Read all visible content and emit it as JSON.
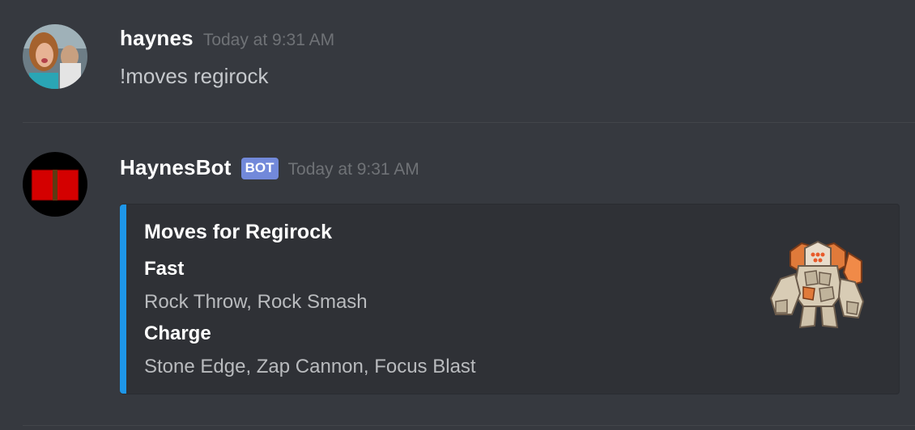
{
  "messages": [
    {
      "username": "haynes",
      "timestamp": "Today at 9:31 AM",
      "content": "!moves regirock"
    },
    {
      "username": "HaynesBot",
      "bot_tag": "BOT",
      "timestamp": "Today at 9:31 AM",
      "embed": {
        "accent_color": "#1e96e8",
        "title": "Moves for Regirock",
        "fields": [
          {
            "name": "Fast",
            "value": "Rock Throw, Rock Smash"
          },
          {
            "name": "Charge",
            "value": "Stone Edge, Zap Cannon, Focus Blast"
          }
        ],
        "thumbnail_icon": "regirock-sprite-icon"
      }
    }
  ],
  "colors": {
    "background": "#36393f",
    "embed_background": "#2f3136",
    "bot_tag": "#7289da",
    "username": "#ffffff",
    "timestamp": "#6f7276",
    "message_text": "#c5c8cc"
  }
}
